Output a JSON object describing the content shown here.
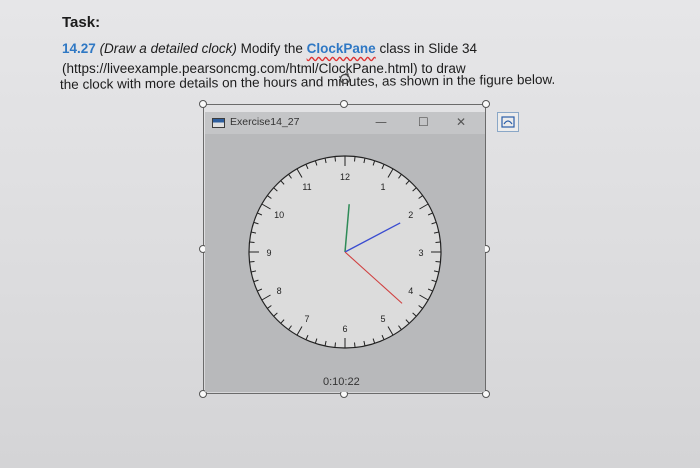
{
  "task": {
    "heading": "Task:",
    "number": "14.27",
    "title": "(Draw a detailed clock)",
    "text_a": " Modify the ",
    "link": "ClockPane",
    "text_b": " class in Slide 34",
    "line2": "(https://liveexample.pearsoncmg.com/html/ClockPane.html) to draw",
    "line3": "the clock with more details on the hours and minutes, as shown in the figure below."
  },
  "window": {
    "title": "Exercise14_27",
    "minimize_glyph": "—",
    "maximize_glyph": "☐",
    "close_glyph": "✕"
  },
  "clock": {
    "hour": 0,
    "minute": 10,
    "second": 22,
    "time_text": "0:10:22",
    "hour_labels": [
      "12",
      "1",
      "2",
      "3",
      "4",
      "5",
      "6",
      "7",
      "8",
      "9",
      "10",
      "11"
    ],
    "colors": {
      "hour_hand": "#2e8b57",
      "minute_hand": "#3a4cd0",
      "second_hand": "#d04040"
    }
  },
  "icons": {
    "app": "app-window-icon",
    "side_button": "image-toggle-icon",
    "cursor": "rotate-cursor-icon"
  }
}
